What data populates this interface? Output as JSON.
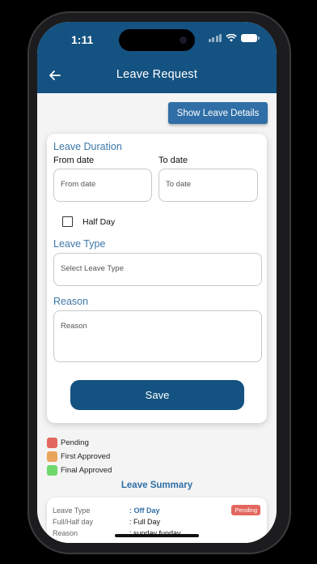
{
  "status_bar": {
    "time": "1:11"
  },
  "appbar": {
    "title": "Leave Request"
  },
  "actions": {
    "show_details": "Show Leave Details"
  },
  "form": {
    "duration_title": "Leave Duration",
    "from_label": "From date",
    "from_placeholder": "From date",
    "to_label": "To date",
    "to_placeholder": "To date",
    "half_day_label": "Half Day",
    "leave_type_title": "Leave Type",
    "leave_type_placeholder": "Select Leave Type",
    "reason_title": "Reason",
    "reason_placeholder": "Reason",
    "save_label": "Save"
  },
  "legend": [
    {
      "label": "Pending",
      "color": "#e2675e"
    },
    {
      "label": "First Approved",
      "color": "#e9a55c"
    },
    {
      "label": "Final Approved",
      "color": "#6fd86a"
    }
  ],
  "summary": {
    "title": "Leave Summary",
    "leave_type_key": "Leave Type",
    "leave_type_val": ": Off Day",
    "full_half_key": "Full/Half day",
    "full_half_val": ": Full Day",
    "reason_key": "Reason",
    "reason_val": ": sunday funday",
    "status": "Pending"
  },
  "colors": {
    "primary": "#145281",
    "accent": "#2f6ea6",
    "pending": "#e2675e"
  }
}
